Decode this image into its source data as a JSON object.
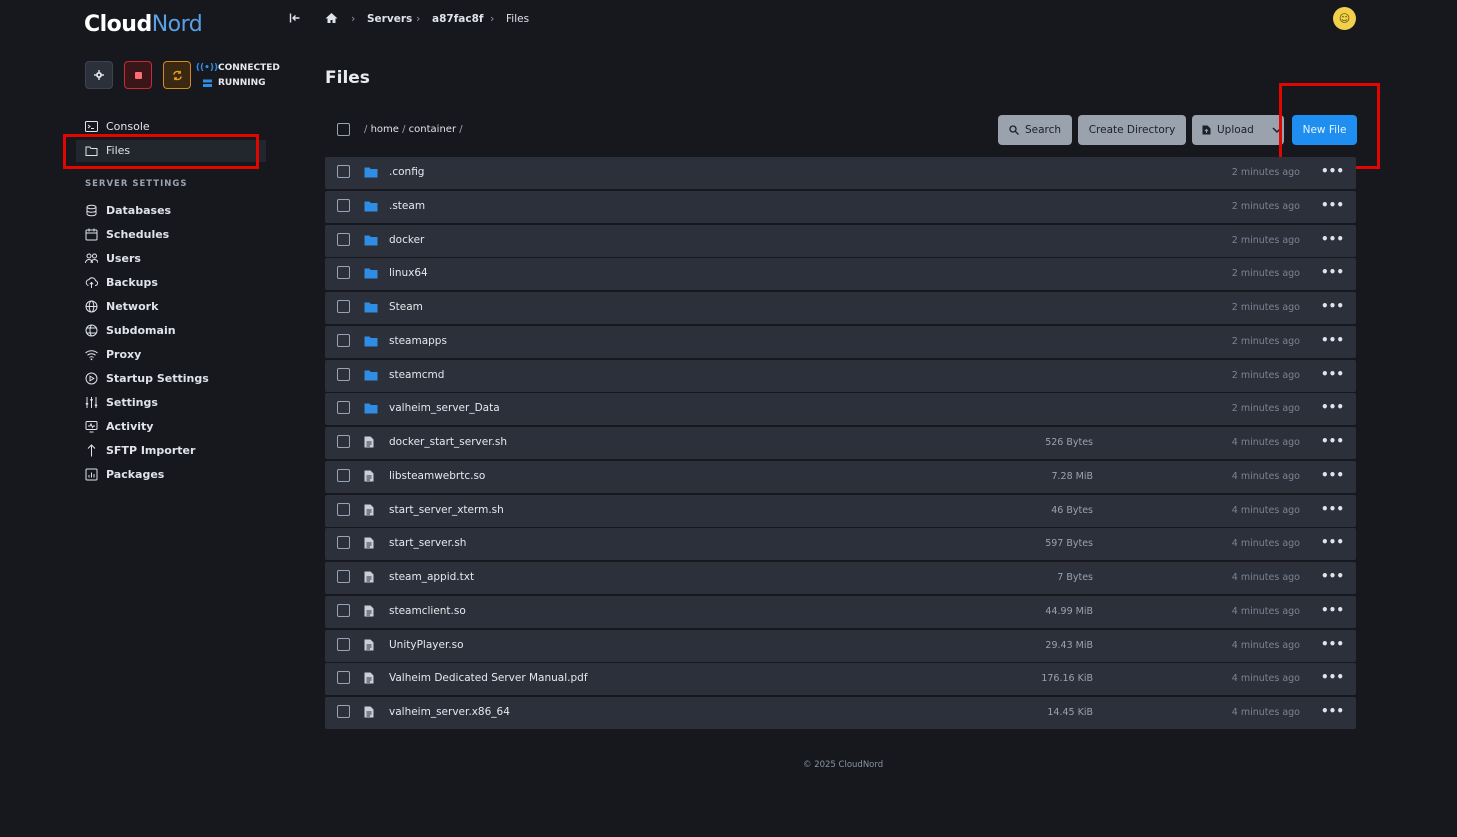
{
  "brand": {
    "logo_first": "Cloud",
    "logo_second": "Nord"
  },
  "status": {
    "connection": "CONNECTED",
    "state": "RUNNING"
  },
  "nav": {
    "console": "Console",
    "files": "Files",
    "section_title": "SERVER SETTINGS",
    "items": [
      "Databases",
      "Schedules",
      "Users",
      "Backups",
      "Network",
      "Subdomain",
      "Proxy",
      "Startup Settings",
      "Settings",
      "Activity",
      "SFTP Importer",
      "Packages"
    ]
  },
  "breadcrumb": {
    "servers": "Servers",
    "server_id": "a87fac8f",
    "current": "Files"
  },
  "page_title": "Files",
  "path": {
    "root": "/",
    "home": "home",
    "sep": "/",
    "container": "container",
    "trail": "/"
  },
  "toolbar": {
    "search": "Search",
    "create_dir": "Create Directory",
    "upload": "Upload",
    "new_file": "New File"
  },
  "files": [
    {
      "type": "folder",
      "name": ".config",
      "size": "",
      "modified": "2 minutes ago"
    },
    {
      "type": "folder",
      "name": ".steam",
      "size": "",
      "modified": "2 minutes ago"
    },
    {
      "type": "folder",
      "name": "docker",
      "size": "",
      "modified": "2 minutes ago"
    },
    {
      "type": "folder",
      "name": "linux64",
      "size": "",
      "modified": "2 minutes ago"
    },
    {
      "type": "folder",
      "name": "Steam",
      "size": "",
      "modified": "2 minutes ago"
    },
    {
      "type": "folder",
      "name": "steamapps",
      "size": "",
      "modified": "2 minutes ago"
    },
    {
      "type": "folder",
      "name": "steamcmd",
      "size": "",
      "modified": "2 minutes ago"
    },
    {
      "type": "folder",
      "name": "valheim_server_Data",
      "size": "",
      "modified": "2 minutes ago"
    },
    {
      "type": "file",
      "name": "docker_start_server.sh",
      "size": "526 Bytes",
      "modified": "4 minutes ago"
    },
    {
      "type": "file",
      "name": "libsteamwebrtc.so",
      "size": "7.28 MiB",
      "modified": "4 minutes ago"
    },
    {
      "type": "file",
      "name": "start_server_xterm.sh",
      "size": "46 Bytes",
      "modified": "4 minutes ago"
    },
    {
      "type": "file",
      "name": "start_server.sh",
      "size": "597 Bytes",
      "modified": "4 minutes ago"
    },
    {
      "type": "file",
      "name": "steam_appid.txt",
      "size": "7 Bytes",
      "modified": "4 minutes ago"
    },
    {
      "type": "file",
      "name": "steamclient.so",
      "size": "44.99 MiB",
      "modified": "4 minutes ago"
    },
    {
      "type": "file",
      "name": "UnityPlayer.so",
      "size": "29.43 MiB",
      "modified": "4 minutes ago"
    },
    {
      "type": "file",
      "name": "Valheim Dedicated Server Manual.pdf",
      "size": "176.16 KiB",
      "modified": "4 minutes ago"
    },
    {
      "type": "file",
      "name": "valheim_server.x86_64",
      "size": "14.45 KiB",
      "modified": "4 minutes ago"
    }
  ],
  "row_menu_glyph": "•••",
  "footer": "© 2025 CloudNord",
  "colors": {
    "accent": "#1f8ef1",
    "bg": "#16181d",
    "row": "#2b303a",
    "highlight": "#e10600",
    "folder": "#2f8de4"
  }
}
